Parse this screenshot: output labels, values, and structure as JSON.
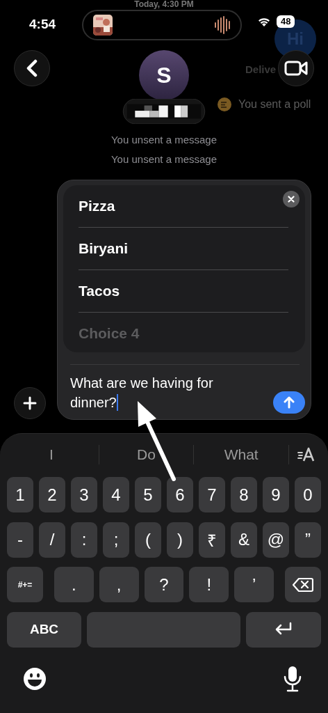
{
  "background": {
    "date_header": "Today, 4:30 PM",
    "bubble_text": "Hi",
    "receipt": "Delive",
    "poll_notice": "You sent a poll"
  },
  "status_bar": {
    "time": "4:54",
    "battery": "48"
  },
  "header": {
    "avatar_initial": "S"
  },
  "system_messages": [
    "You unsent a message",
    "You unsent a message"
  ],
  "poll": {
    "options": [
      {
        "text": "Pizza",
        "kind": "value"
      },
      {
        "text": "Biryani",
        "kind": "value"
      },
      {
        "text": "Tacos",
        "kind": "value"
      },
      {
        "text": "Choice 4",
        "kind": "placeholder"
      }
    ],
    "question": "What are we having for dinner?"
  },
  "keyboard": {
    "suggestions": [
      "I",
      "Do",
      "What"
    ],
    "number_keys": [
      {
        "label": "1",
        "kind": "char"
      },
      {
        "label": "2",
        "kind": "char"
      },
      {
        "label": "3",
        "kind": "char"
      },
      {
        "label": "4",
        "kind": "char"
      },
      {
        "label": "5",
        "kind": "char"
      },
      {
        "label": "6",
        "kind": "char"
      },
      {
        "label": "7",
        "kind": "char"
      },
      {
        "label": "8",
        "kind": "char"
      },
      {
        "label": "9",
        "kind": "char"
      },
      {
        "label": "0",
        "kind": "char"
      }
    ],
    "symbol_keys": [
      {
        "label": "-",
        "kind": "char"
      },
      {
        "label": "/",
        "kind": "char"
      },
      {
        "label": ":",
        "kind": "char"
      },
      {
        "label": ";",
        "kind": "char"
      },
      {
        "label": "(",
        "kind": "char"
      },
      {
        "label": ")",
        "kind": "char"
      },
      {
        "label": "₹",
        "kind": "char"
      },
      {
        "label": "&",
        "kind": "char"
      },
      {
        "label": "@",
        "kind": "char"
      },
      {
        "label": "”",
        "kind": "char"
      }
    ],
    "punctuation_keys": [
      {
        "label": "#+=",
        "kind": "shift"
      },
      {
        "label": ".",
        "kind": "char"
      },
      {
        "label": ",",
        "kind": "char"
      },
      {
        "label": "?",
        "kind": "char"
      },
      {
        "label": "!",
        "kind": "char"
      },
      {
        "label": "’",
        "kind": "char"
      },
      {
        "kind": "delete"
      }
    ],
    "bottom_keys": [
      {
        "label": "ABC",
        "kind": "mode"
      },
      {
        "kind": "space"
      },
      {
        "kind": "return"
      }
    ]
  }
}
